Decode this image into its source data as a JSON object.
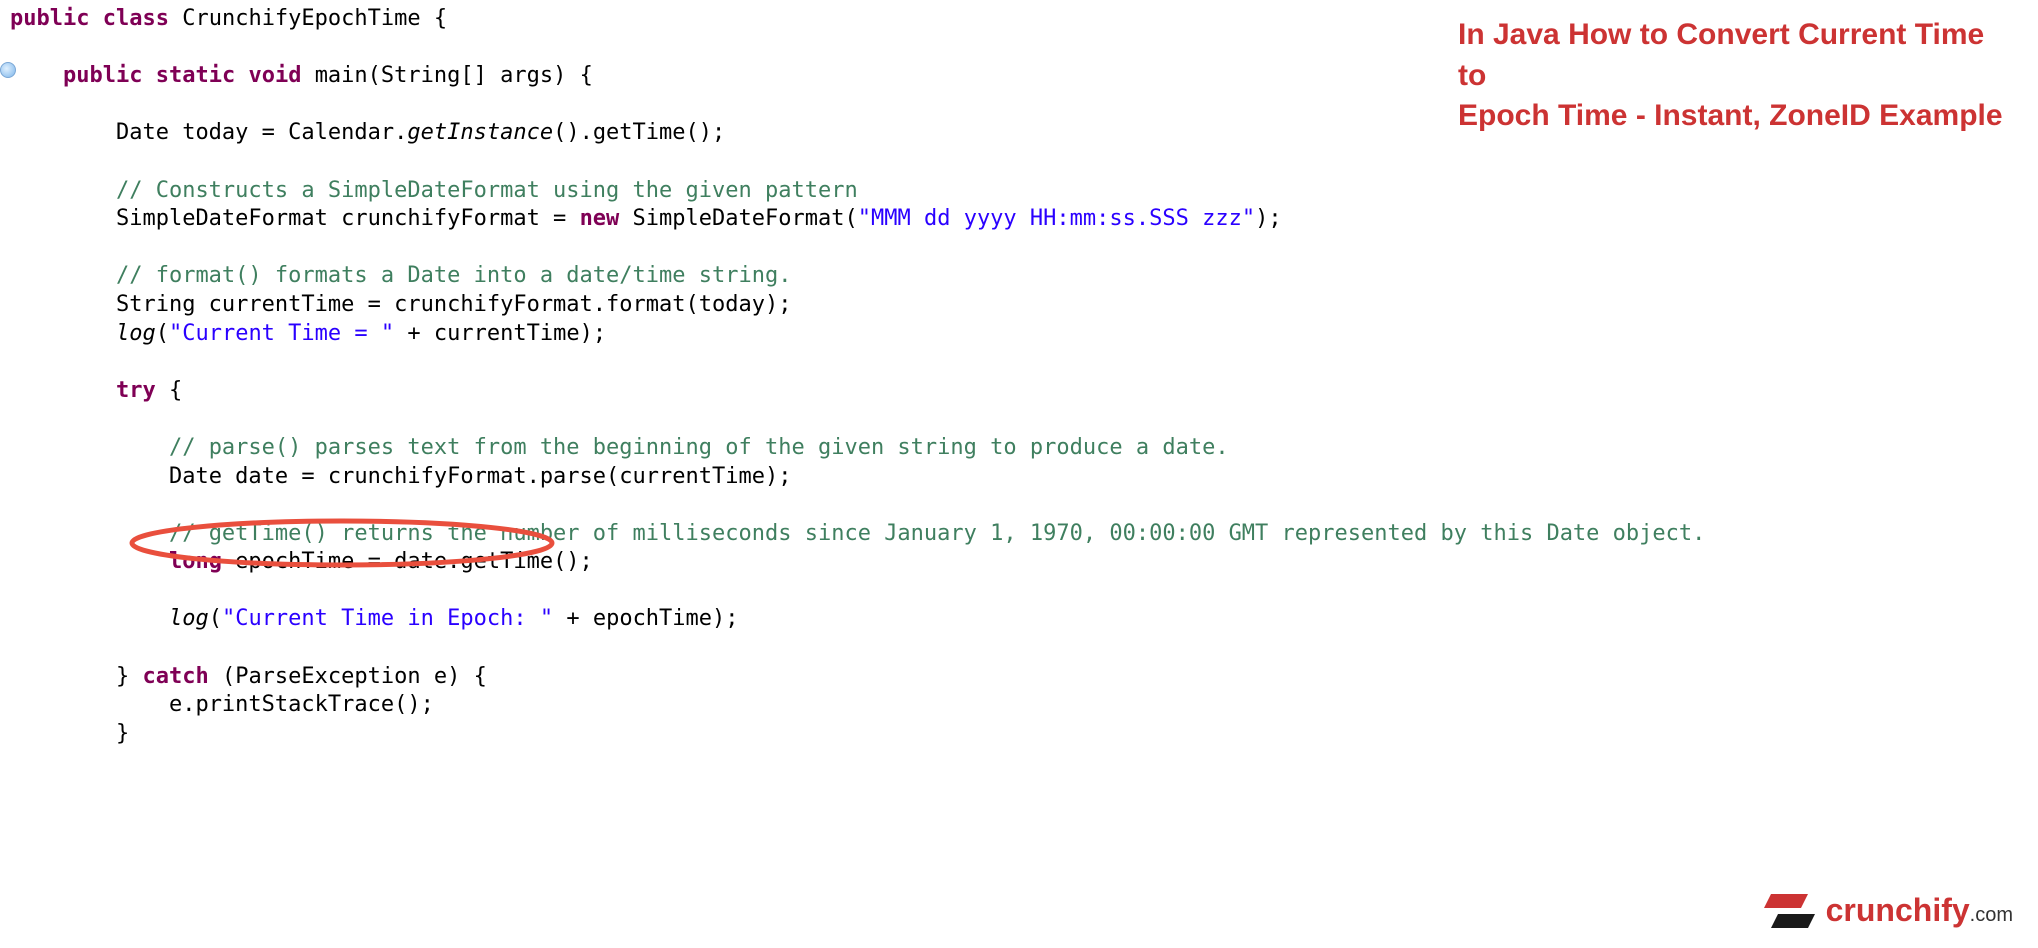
{
  "title": {
    "line1": "In Java How to Convert Current Time to",
    "line2": "Epoch Time - Instant, ZoneID Example"
  },
  "logo": {
    "name": "crunchify",
    "suffix": ".com"
  },
  "code": {
    "l1_kw1": "public",
    "l1_kw2": "class",
    "l1_name": "CrunchifyEpochTime",
    "l1_brace": " {",
    "l3_kw1": "public",
    "l3_kw2": "static",
    "l3_kw3": "void",
    "l3_sig": "main(String[] args) {",
    "l5": "Date today = Calendar.",
    "l5_m": "getInstance",
    "l5_rest": "().getTime();",
    "l7_comment": "// Constructs a SimpleDateFormat using the given pattern",
    "l8a": "SimpleDateFormat crunchifyFormat = ",
    "l8_new": "new",
    "l8b": " SimpleDateFormat(",
    "l8_str": "\"MMM dd yyyy HH:mm:ss.SSS zzz\"",
    "l8c": ");",
    "l10_comment": "// format() formats a Date into a date/time string.",
    "l11": "String currentTime = crunchifyFormat.format(today);",
    "l12_m": "log",
    "l12a": "(",
    "l12_str": "\"Current Time = \"",
    "l12b": " + currentTime);",
    "l14_try": "try",
    "l14_brace": " {",
    "l16_comment": "// parse() parses text from the beginning of the given string to produce a date.",
    "l17": "Date date = crunchifyFormat.parse(currentTime);",
    "l19_comment": "// getTime() returns the number of milliseconds since January 1, 1970, 00:00:00 GMT represented by this Date object.",
    "l20_kw": "long",
    "l20": " epochTime = date.getTime();",
    "l22_m": "log",
    "l22a": "(",
    "l22_str": "\"Current Time in Epoch: \"",
    "l22b": " + epochTime);",
    "l24a": "} ",
    "l24_catch": "catch",
    "l24b": " (ParseException e) {",
    "l25": "e.printStackTrace();",
    "l26": "}"
  }
}
